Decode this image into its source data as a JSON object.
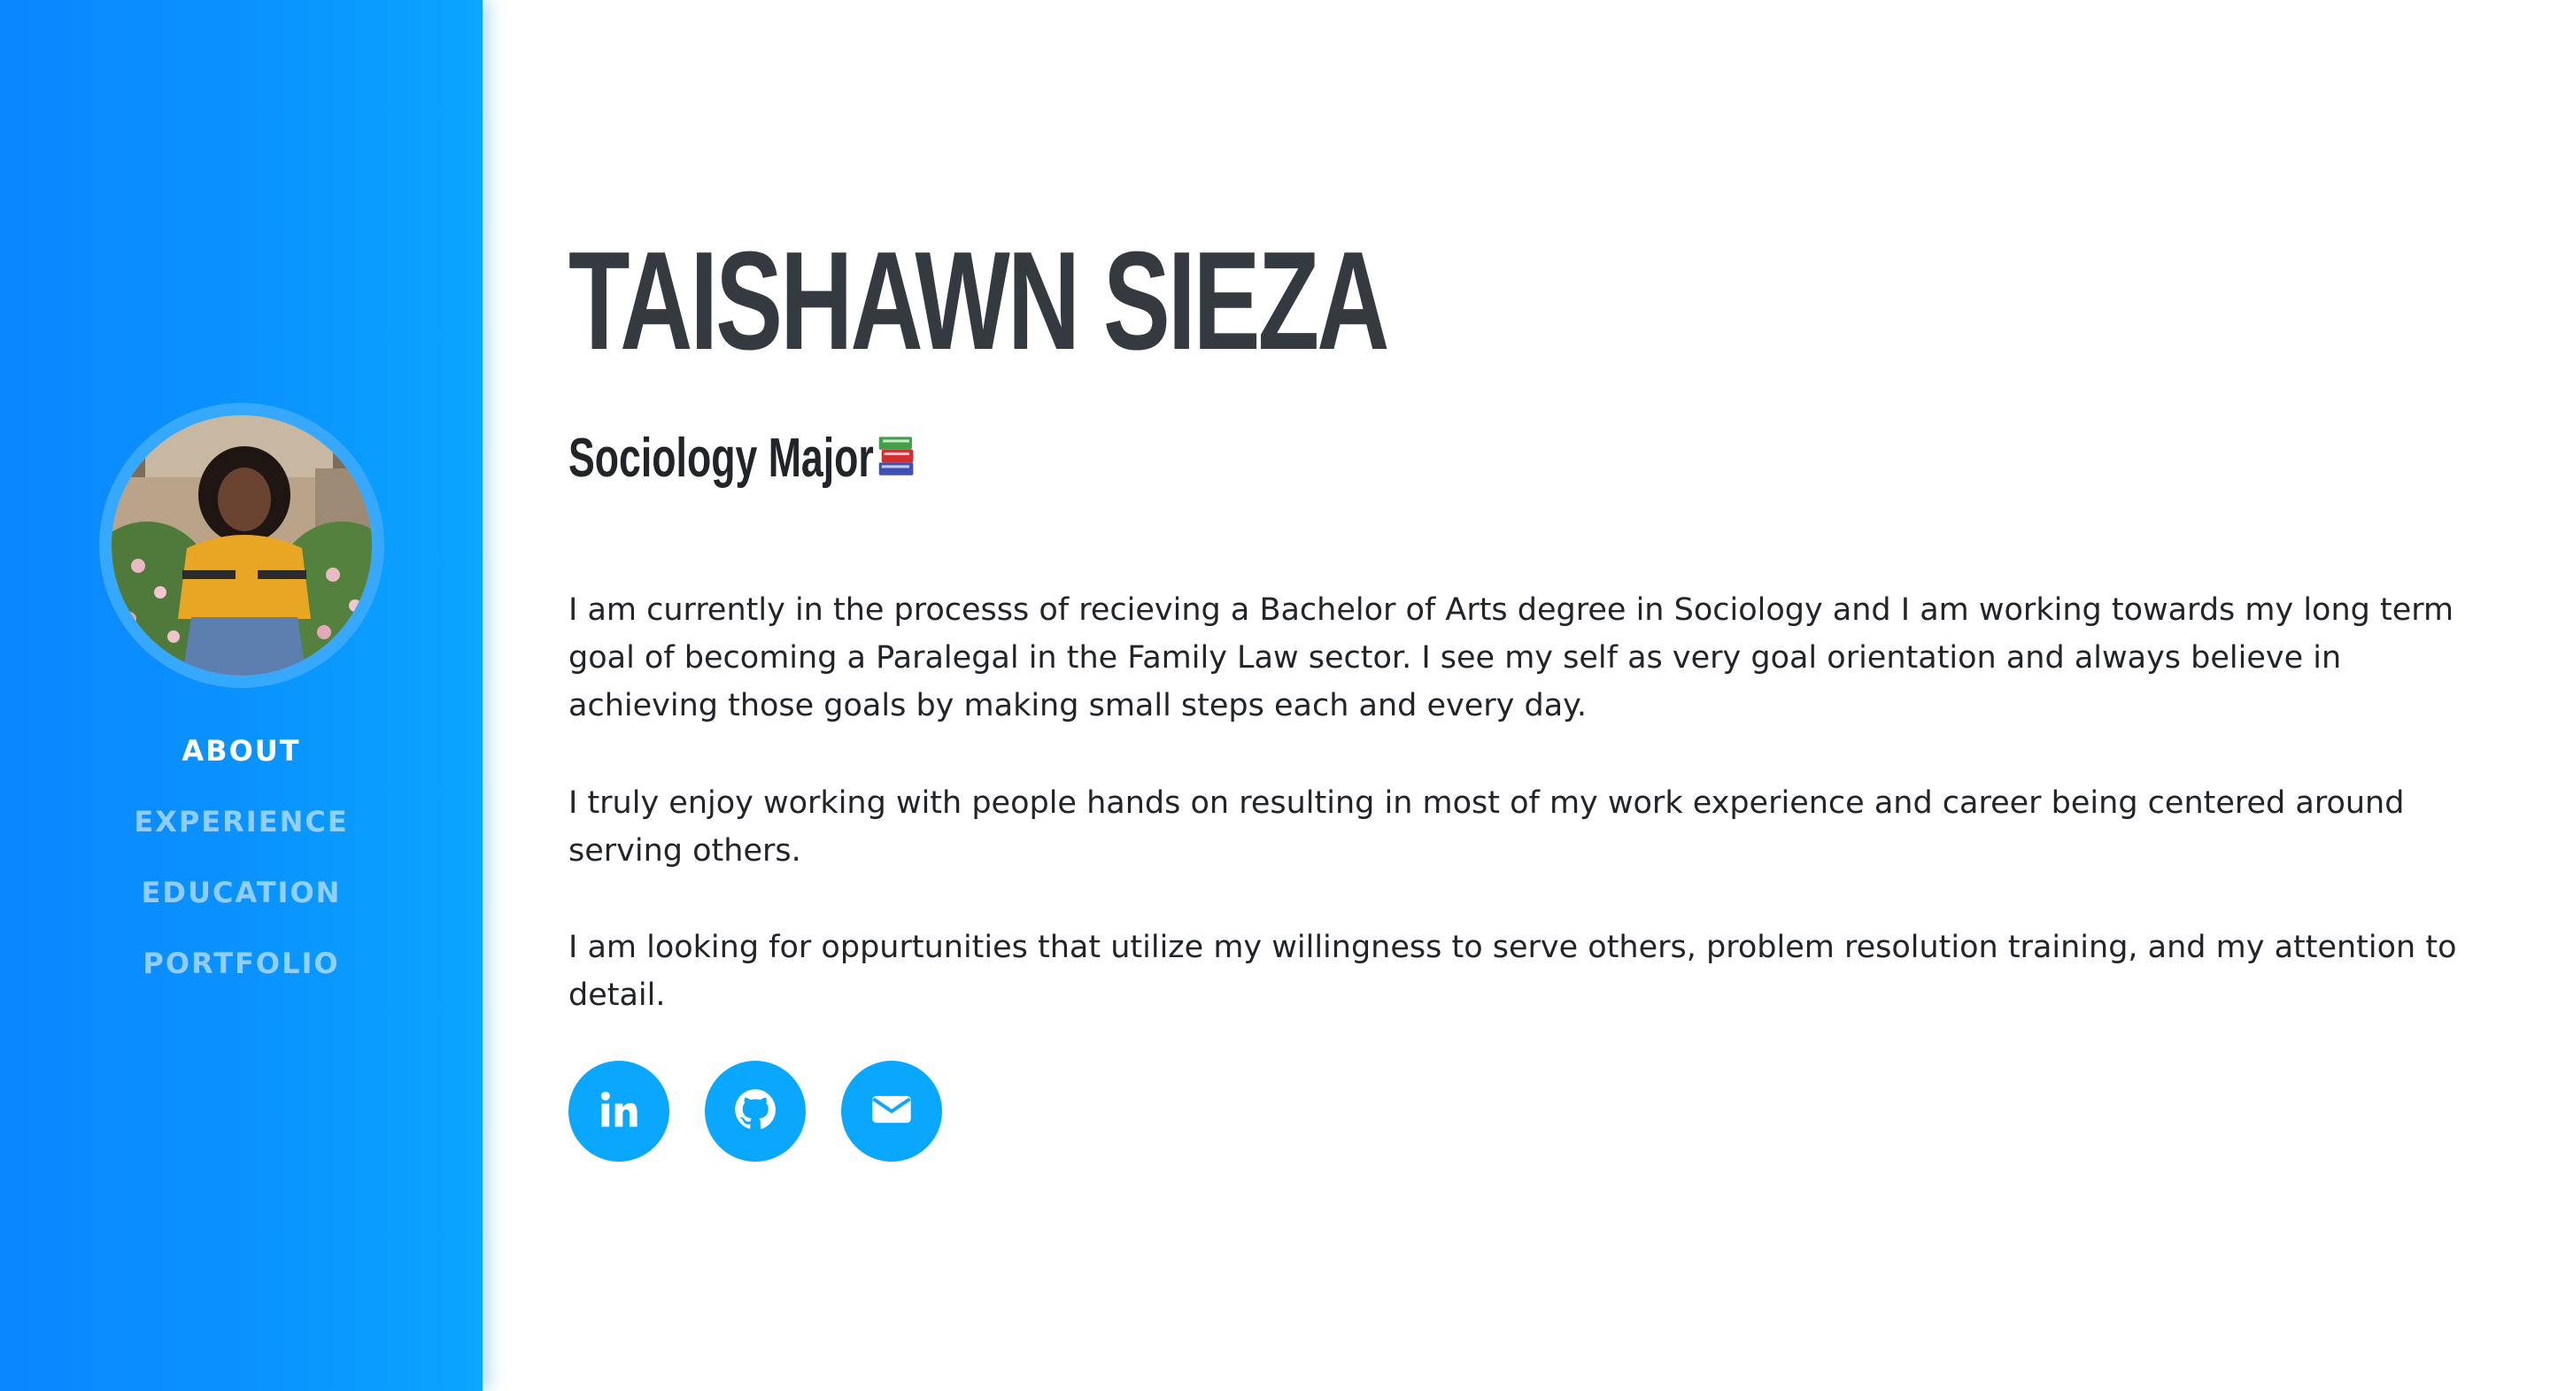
{
  "profile": {
    "name": "TAISHAWN SIEZA",
    "subtitle": "Sociology Major",
    "avatar_alt": "Profile photo"
  },
  "nav": {
    "items": [
      {
        "label": "ABOUT",
        "active": true
      },
      {
        "label": "EXPERIENCE",
        "active": false
      },
      {
        "label": "EDUCATION",
        "active": false
      },
      {
        "label": "PORTFOLIO",
        "active": false
      }
    ]
  },
  "about": {
    "paragraphs": [
      "I am currently in the processs of recieving a Bachelor of Arts degree in Sociology and I am working towards my long term goal of becoming a Paralegal in the Family Law sector. I see my self as very goal orientation and always believe in achieving those goals by making small steps each and every day.",
      "I truly enjoy working with people hands on resulting in most of my work experience and career being centered around serving others.",
      "I am looking for oppurtunities that utilize my willingness to serve others, problem resolution training, and my attention to detail."
    ]
  },
  "social": {
    "links": [
      {
        "icon": "linkedin-icon"
      },
      {
        "icon": "github-icon"
      },
      {
        "icon": "envelope-icon"
      }
    ]
  },
  "colors": {
    "sidebar": "#0a95ff",
    "accent": "#0aa7ff",
    "heading": "#343a40",
    "text": "#212529"
  }
}
